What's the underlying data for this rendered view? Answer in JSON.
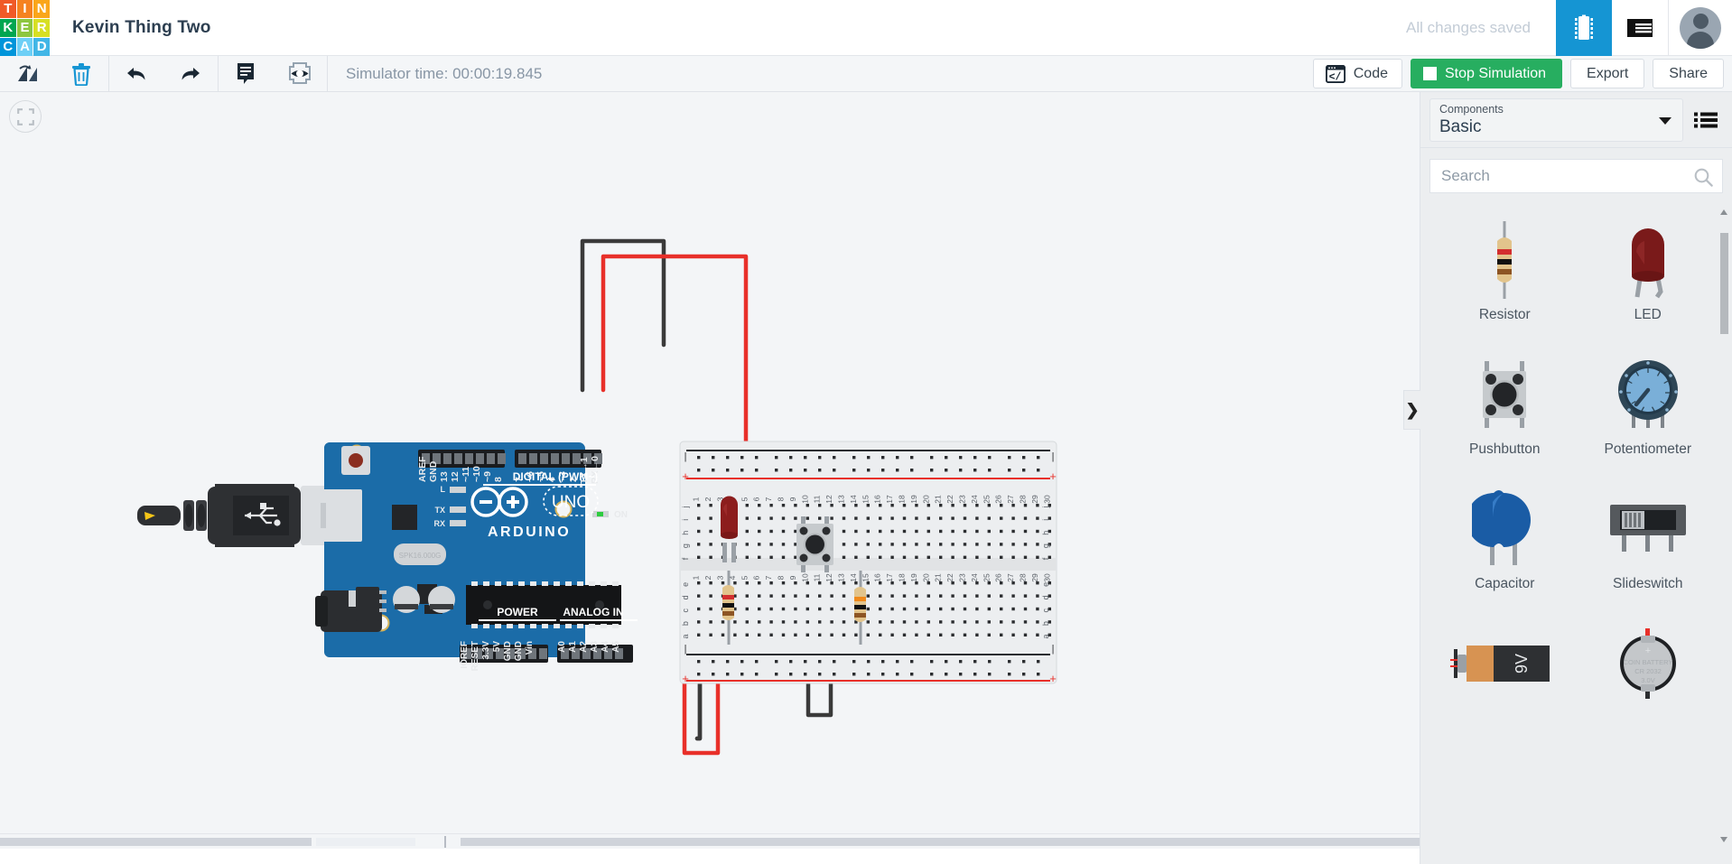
{
  "app": {
    "logo_letters": [
      "T",
      "I",
      "N",
      "K",
      "E",
      "R",
      "C",
      "A",
      "D"
    ],
    "logo_colors": [
      "#f05a28",
      "#f58220",
      "#faa61a",
      "#00a651",
      "#8dc63f",
      "#d7df23",
      "#0095da",
      "#6dcff6",
      "#41b6e6"
    ],
    "document_title": "Kevin Thing Two",
    "save_status": "All changes saved",
    "circuit_icon": "circuit-chip-icon",
    "list_icon": "component-list-icon",
    "avatar": "user-avatar"
  },
  "toolbar": {
    "rotate_label": "Rotate",
    "delete_label": "Delete",
    "undo_label": "Undo",
    "redo_label": "Redo",
    "notes_label": "Notes",
    "annotation_label": "Annotation",
    "simulator_time": "Simulator time: 00:00:19.845",
    "code_label": "Code",
    "stop_label": "Stop Simulation",
    "export_label": "Export",
    "share_label": "Share",
    "accent_green": "#27ae60",
    "accent_blue": "#1595d3"
  },
  "canvas": {
    "fit_view_label": "Fit view to selection",
    "board": {
      "name": "Arduino Uno R3",
      "brand": "ARDUINO",
      "model": "UNO",
      "digital_header_label": "DIGITAL (PWM~)",
      "digital_pins": [
        "AREF",
        "GND",
        "13",
        "12",
        "~11",
        "~10",
        "~9",
        "8"
      ],
      "digital_pins_right": [
        "7",
        "~6",
        "~5",
        "4",
        "~3",
        "2",
        "TX→1",
        "RX←0"
      ],
      "power_label": "POWER",
      "power_pins": [
        "IOREF",
        "RESET",
        "3.3V",
        "5V",
        "GND",
        "GND",
        "Vin"
      ],
      "analog_label": "ANALOG IN",
      "analog_pins": [
        "A0",
        "A1",
        "A2",
        "A3",
        "A4",
        "A5"
      ],
      "leds": [
        "L",
        "TX",
        "RX"
      ],
      "on_label": "ON",
      "crystal_label": "SPK16.000G"
    },
    "breadboard": {
      "name": "Breadboard Small",
      "columns": [
        1,
        2,
        3,
        4,
        5,
        6,
        7,
        8,
        9,
        10,
        11,
        12,
        13,
        14,
        15,
        16,
        17,
        18,
        19,
        20,
        21,
        22,
        23,
        24,
        25,
        26,
        27,
        28,
        29,
        30
      ],
      "rows_top": [
        "j",
        "i",
        "h",
        "g",
        "f"
      ],
      "rows_bottom": [
        "e",
        "d",
        "c",
        "b",
        "a"
      ],
      "rail_plus": "+",
      "rail_minus": "|"
    },
    "components_on_canvas": [
      {
        "name": "led",
        "label": "LED",
        "color": "#8c1d1d",
        "column": 5
      },
      {
        "name": "pushbutton",
        "label": "Pushbutton",
        "column": 11
      },
      {
        "name": "resistor-1",
        "label": "Resistor",
        "column": 4,
        "bands": [
          "#d32f2f",
          "#111111",
          "#8d5524"
        ]
      },
      {
        "name": "resistor-2",
        "label": "Resistor",
        "column": 15,
        "bands": [
          "#f08a1c",
          "#111111",
          "#8d5524"
        ]
      },
      {
        "name": "usb-cable",
        "label": "USB cable"
      }
    ],
    "wire_colors": {
      "red": "#e8302a",
      "black": "#3a3a3a"
    }
  },
  "panel": {
    "select_caption": "Components",
    "select_value": "Basic",
    "list_view_label": "List view",
    "search": {
      "value": "",
      "placeholder": "Search"
    },
    "collapse_label": "Collapse panel",
    "components": [
      {
        "name": "resistor",
        "label": "Resistor"
      },
      {
        "name": "led",
        "label": "LED"
      },
      {
        "name": "pushbutton",
        "label": "Pushbutton"
      },
      {
        "name": "potentiometer",
        "label": "Potentiometer"
      },
      {
        "name": "capacitor",
        "label": "Capacitor"
      },
      {
        "name": "slideswitch",
        "label": "Slideswitch"
      },
      {
        "name": "battery-9v",
        "label": "",
        "face_text": "9V"
      },
      {
        "name": "coin-battery",
        "label": "",
        "face_lines": [
          "COIN BATTERY",
          "CR 2032",
          "3.0V"
        ]
      }
    ]
  }
}
